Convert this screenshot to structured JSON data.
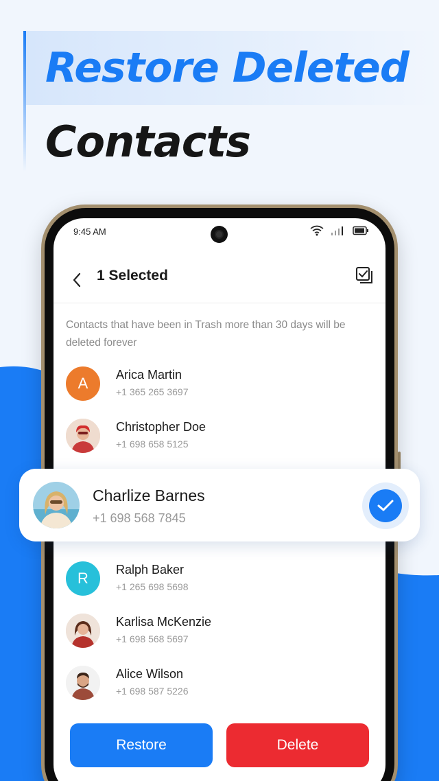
{
  "headline": {
    "line1": "Restore Deleted",
    "line2": "Contacts"
  },
  "status_bar": {
    "time": "9:45 AM",
    "icons": [
      "wifi-icon",
      "signal-icon",
      "battery-icon"
    ]
  },
  "app_bar": {
    "back_icon": "chevron-left-icon",
    "title": "1 Selected",
    "select_all_icon": "select-all-icon"
  },
  "notice": "Contacts that have been in Trash more than 30 days will be deleted forever",
  "contacts": [
    {
      "name": "Arica Martin",
      "phone": "+1 365 265 3697",
      "avatar": "initial",
      "initial": "A",
      "color": "#ec7b2c"
    },
    {
      "name": "Christopher Doe",
      "phone": "+1 698 658 5125",
      "avatar": "photo",
      "color": "#c93a3a"
    },
    {
      "name": "Ralph Baker",
      "phone": "+1 265 698 5698",
      "avatar": "initial",
      "initial": "R",
      "color": "#27c0da"
    },
    {
      "name": "Karlisa McKenzie",
      "phone": "+1 698 568 5697",
      "avatar": "photo",
      "color": "#b5322c"
    },
    {
      "name": "Alice Wilson",
      "phone": "+1 698 587 5226",
      "avatar": "photo",
      "color": "#9c4b3a"
    }
  ],
  "selected_contact": {
    "name": "Charlize Barnes",
    "phone": "+1 698 568 7845",
    "selected": true,
    "check_icon": "check-icon"
  },
  "actions": {
    "restore_label": "Restore",
    "delete_label": "Delete"
  },
  "colors": {
    "accent": "#1a7cf5",
    "danger": "#ec2b31",
    "background": "#f1f6fd"
  }
}
